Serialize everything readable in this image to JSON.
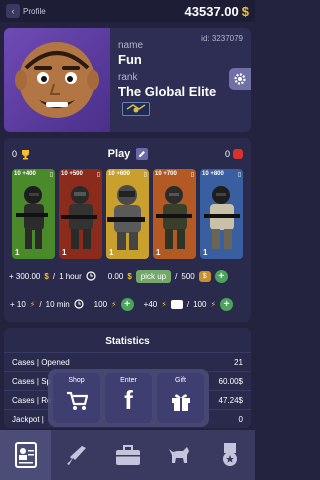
{
  "topbar": {
    "back_label": "Profile",
    "balance": "43537.00",
    "currency_symbol": "$"
  },
  "profile": {
    "id_text": "id: 3237079",
    "name_label": "name",
    "name_value": "Fun",
    "rank_label": "rank",
    "rank_value": "The Global Elite"
  },
  "play": {
    "title": "Play",
    "left_count": "0",
    "right_count": "0",
    "cards": [
      {
        "top": "10 +400",
        "count": "1",
        "color": "#4b8a2a"
      },
      {
        "top": "10 +500",
        "count": "1",
        "color": "#8a2b1c"
      },
      {
        "top": "10 +600",
        "count": "1",
        "color": "#c9a02e"
      },
      {
        "top": "10 +700",
        "count": "1",
        "color": "#b35a24"
      },
      {
        "top": "10 +800",
        "count": "1",
        "color": "#3a5fa0"
      }
    ],
    "money_per_hour": "+ 300.00",
    "money_unit": "$",
    "slash1": "/",
    "hour_label": "1 hour",
    "current_money": "0.00",
    "pickup_label": "pick up",
    "slash2": "/",
    "max_money": "500",
    "energy_gain": "+ 10",
    "slash3": "/",
    "energy_time": "10 min",
    "energy_amount": "100",
    "video_gain": "+40",
    "slash4": "/",
    "energy_max": "100"
  },
  "stats": {
    "title": "Statistics",
    "rows": [
      {
        "label": "Cases | Opened",
        "value": "21"
      },
      {
        "label": "Cases | Sp",
        "value": "60.00$"
      },
      {
        "label": "Cases | Re",
        "value": "47.24$"
      },
      {
        "label": "Jackpot | ",
        "value": "0"
      }
    ]
  },
  "popup": {
    "shop_label": "Shop",
    "enter_label": "Enter",
    "gift_label": "Gift"
  },
  "colors": {
    "background": "#23233f",
    "panel": "#2a2a4d",
    "accent_green": "#4ca45c",
    "coin": "#f5c028"
  }
}
